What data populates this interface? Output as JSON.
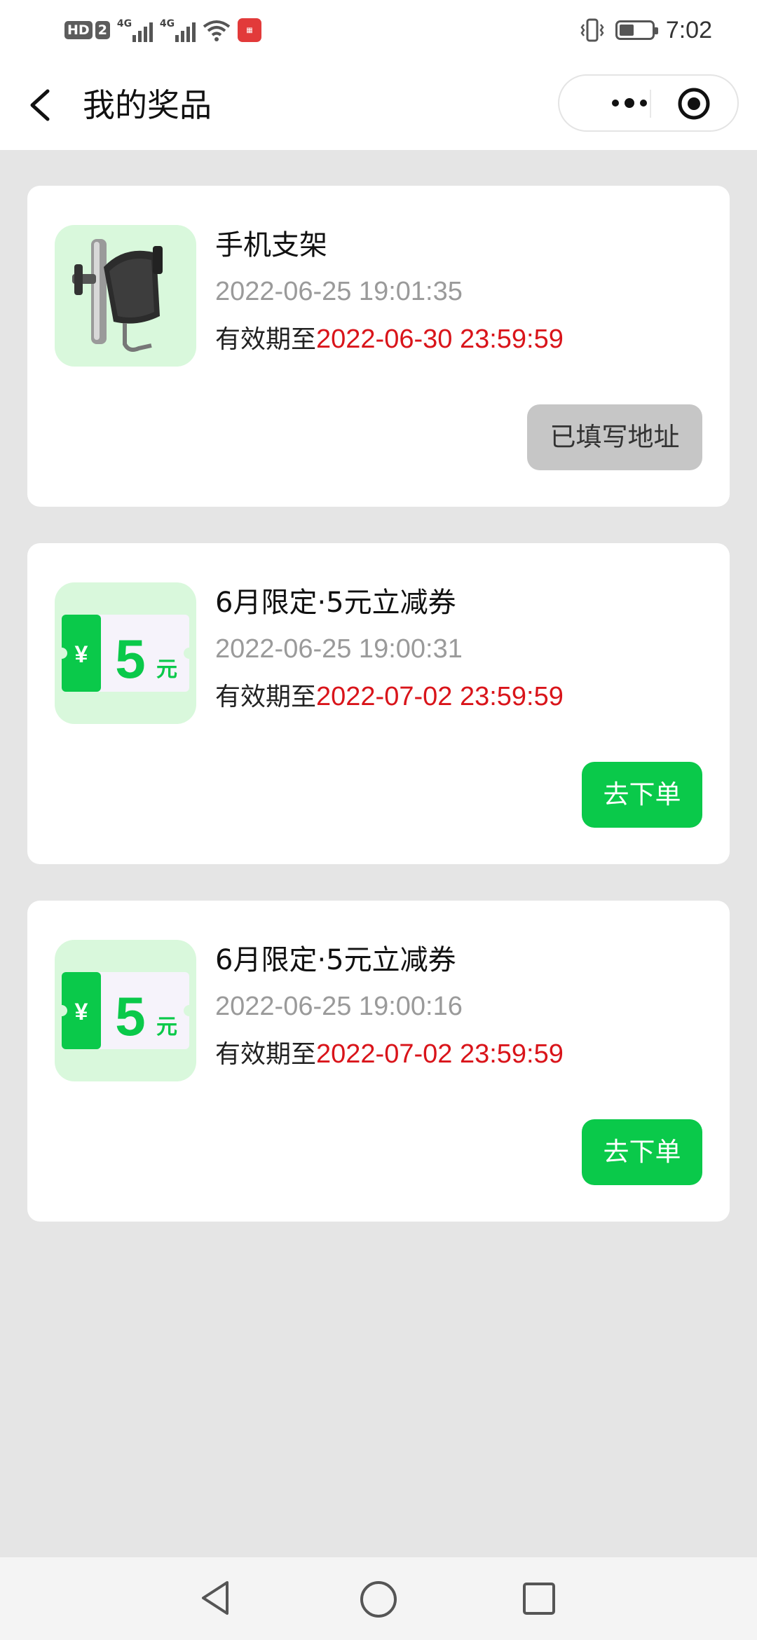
{
  "status_bar": {
    "hd_label": "HD",
    "sim_label": "2",
    "signal_1": "4G",
    "signal_2": "4G",
    "time": "7:02",
    "battery_level": 0.45
  },
  "nav": {
    "title": "我的奖品"
  },
  "prizes": [
    {
      "name": "手机支架",
      "timestamp": "2022-06-25 19:01:35",
      "valid_prefix": "有效期至",
      "valid_until": "2022-06-30 23:59:59",
      "action_label": "已填写地址",
      "action_style": "gray",
      "thumb": "phone-holder-image"
    },
    {
      "name": "6月限定·5元立减券",
      "timestamp": "2022-06-25 19:00:31",
      "valid_prefix": "有效期至",
      "valid_until": "2022-07-02 23:59:59",
      "action_label": "去下单",
      "action_style": "green",
      "thumb": "coupon-image",
      "coupon_symbol": "¥",
      "coupon_amount": "5",
      "coupon_unit": "元"
    },
    {
      "name": "6月限定·5元立减券",
      "timestamp": "2022-06-25 19:00:16",
      "valid_prefix": "有效期至",
      "valid_until": "2022-07-02 23:59:59",
      "action_label": "去下单",
      "action_style": "green",
      "thumb": "coupon-image",
      "coupon_symbol": "¥",
      "coupon_amount": "5",
      "coupon_unit": "元"
    }
  ],
  "colors": {
    "accent_green": "#0ac94a",
    "expiry_red": "#d9141a",
    "page_bg": "#e5e5e5",
    "thumb_bg": "#d9f8dc"
  }
}
